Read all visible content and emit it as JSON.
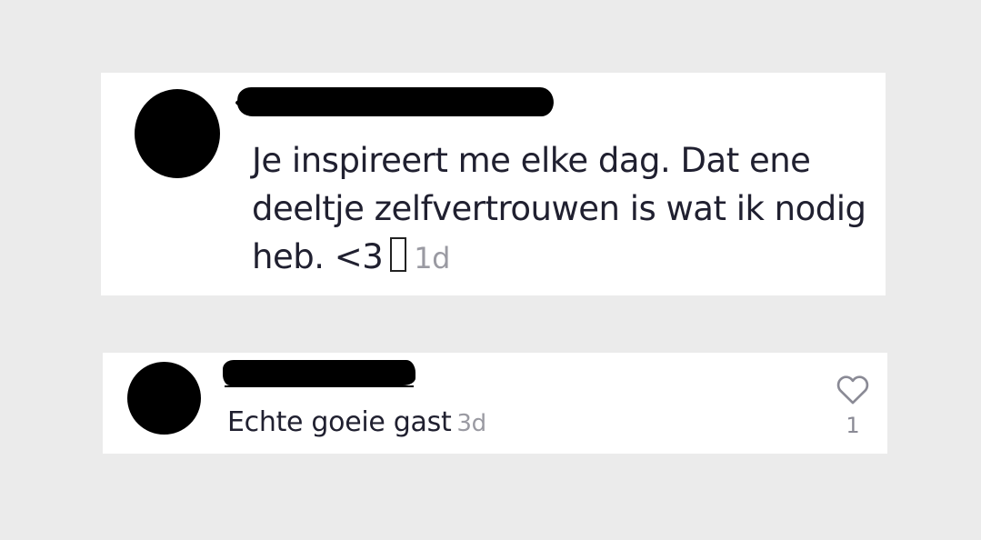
{
  "comments": [
    {
      "text": "Je inspireert me elke dag. Dat ene deeltje zelfvertrouwen is wat ik nodig heb. <3",
      "emoji": "",
      "timestamp": "1d"
    },
    {
      "text": "Echte goeie gast",
      "timestamp": "3d",
      "like_count": "1",
      "like_icon": "heart-outline-icon"
    }
  ],
  "colors": {
    "background": "#ebebeb",
    "card": "#ffffff",
    "text": "#202030",
    "muted": "#9a9aa2",
    "redaction": "#000000"
  }
}
